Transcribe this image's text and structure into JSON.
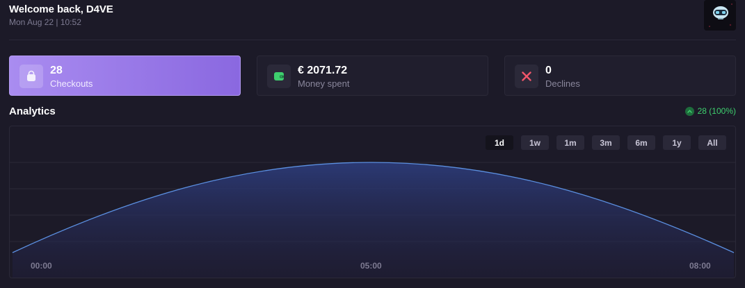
{
  "header": {
    "welcome": "Welcome back, D4VE",
    "datetime": "Mon Aug 22 | 10:52"
  },
  "stats": [
    {
      "value": "28",
      "label": "Checkouts",
      "icon": "shopping-bag-icon"
    },
    {
      "value": "€ 2071.72",
      "label": "Money spent",
      "icon": "wallet-icon",
      "icon_color": "#3ecf6e"
    },
    {
      "value": "0",
      "label": "Declines",
      "icon": "x-mark-icon",
      "icon_color": "#f0566a"
    }
  ],
  "analytics": {
    "title": "Analytics",
    "trend": "28 (100%)",
    "ranges": [
      "1d",
      "1w",
      "1m",
      "3m",
      "6m",
      "1y",
      "All"
    ],
    "selected_range": "1d"
  },
  "colors": {
    "accent": "#9a7ae8",
    "positive": "#3ecf6e",
    "negative": "#f0566a",
    "line": "#5b8fe0"
  },
  "chart_data": {
    "type": "area",
    "x": [
      "00:00",
      "05:00",
      "08:00"
    ],
    "x_ticks": [
      "00:00",
      "05:00",
      "08:00"
    ],
    "curve": "smooth single peak, maximum near 05:00"
  }
}
